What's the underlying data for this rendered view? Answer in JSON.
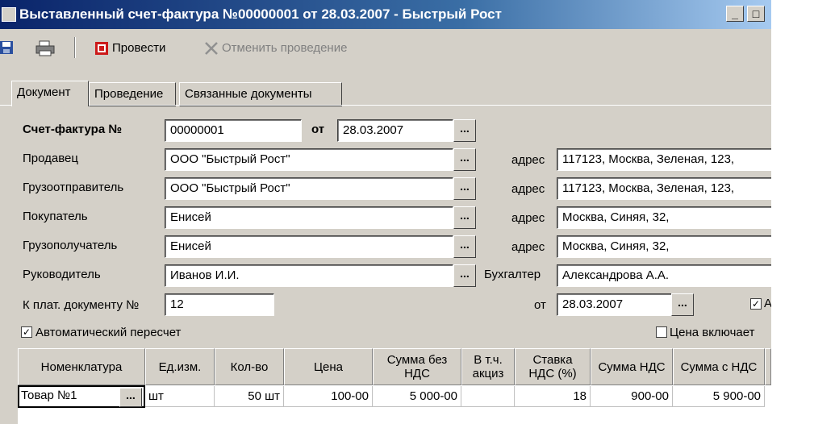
{
  "window": {
    "title": "Выставленный счет-фактура №00000001 от 28.03.2007 - Быстрый Рост",
    "minimize_glyph": "_",
    "maximize_glyph": "□"
  },
  "toolbar": {
    "post_label": "Провести",
    "unpost_label": "Отменить проведение"
  },
  "tabs": [
    "Документ",
    "Проведение",
    "Связанные документы"
  ],
  "form": {
    "invoice_label": "Счет-фактура №",
    "invoice_number": "00000001",
    "from_label": "от",
    "invoice_date": "28.03.2007",
    "seller_label": "Продавец",
    "seller_value": "ООО \"Быстрый Рост\"",
    "shipper_label": "Грузоотправитель",
    "shipper_value": "ООО \"Быстрый Рост\"",
    "buyer_label": "Покупатель",
    "buyer_value": "Енисей",
    "consignee_label": "Грузополучатель",
    "consignee_value": "Енисей",
    "manager_label": "Руководитель",
    "manager_value": "Иванов И.И.",
    "payment_doc_label": "К плат. документу №",
    "payment_doc_value": "12",
    "address_label": "адрес",
    "seller_address": "117123, Москва, Зеленая, 123,",
    "shipper_address": "117123, Москва, Зеленая, 123,",
    "buyer_address": "Москва, Синяя, 32,",
    "consignee_address": "Москва, Синяя, 32,",
    "accountant_label": "Бухгалтер",
    "accountant_value": "Александрова А.А.",
    "payment_from_label": "от",
    "payment_date": "28.03.2007",
    "right_checkbox_label": "А",
    "auto_recalc_label": "Автоматический пересчет",
    "price_includes_label": "Цена включает",
    "dots": "..."
  },
  "table": {
    "columns": [
      "Номенклатура",
      "Ед.изм.",
      "Кол-во",
      "Цена",
      "Сумма без НДС",
      "В т.ч. акциз",
      "Ставка НДС (%)",
      "Сумма НДС",
      "Сумма с НДС"
    ],
    "rows": [
      [
        "Товар №1",
        "шт",
        "50 шт",
        "100-00",
        "5 000-00",
        "",
        "18",
        "900-00",
        "5 900-00"
      ]
    ]
  }
}
